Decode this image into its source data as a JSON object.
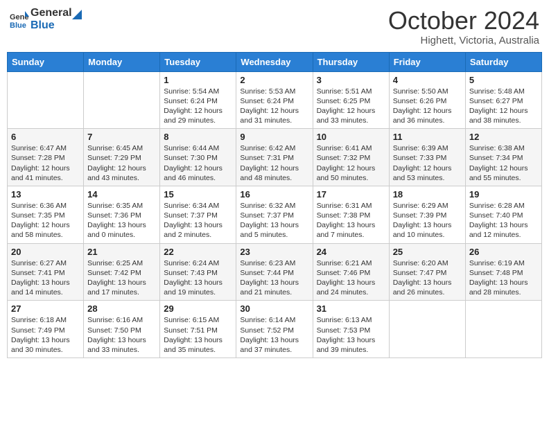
{
  "header": {
    "logo_line1": "General",
    "logo_line2": "Blue",
    "month_title": "October 2024",
    "subtitle": "Highett, Victoria, Australia"
  },
  "weekdays": [
    "Sunday",
    "Monday",
    "Tuesday",
    "Wednesday",
    "Thursday",
    "Friday",
    "Saturday"
  ],
  "weeks": [
    [
      {
        "day": "",
        "info": ""
      },
      {
        "day": "",
        "info": ""
      },
      {
        "day": "1",
        "info": "Sunrise: 5:54 AM\nSunset: 6:24 PM\nDaylight: 12 hours and 29 minutes."
      },
      {
        "day": "2",
        "info": "Sunrise: 5:53 AM\nSunset: 6:24 PM\nDaylight: 12 hours and 31 minutes."
      },
      {
        "day": "3",
        "info": "Sunrise: 5:51 AM\nSunset: 6:25 PM\nDaylight: 12 hours and 33 minutes."
      },
      {
        "day": "4",
        "info": "Sunrise: 5:50 AM\nSunset: 6:26 PM\nDaylight: 12 hours and 36 minutes."
      },
      {
        "day": "5",
        "info": "Sunrise: 5:48 AM\nSunset: 6:27 PM\nDaylight: 12 hours and 38 minutes."
      }
    ],
    [
      {
        "day": "6",
        "info": "Sunrise: 6:47 AM\nSunset: 7:28 PM\nDaylight: 12 hours and 41 minutes."
      },
      {
        "day": "7",
        "info": "Sunrise: 6:45 AM\nSunset: 7:29 PM\nDaylight: 12 hours and 43 minutes."
      },
      {
        "day": "8",
        "info": "Sunrise: 6:44 AM\nSunset: 7:30 PM\nDaylight: 12 hours and 46 minutes."
      },
      {
        "day": "9",
        "info": "Sunrise: 6:42 AM\nSunset: 7:31 PM\nDaylight: 12 hours and 48 minutes."
      },
      {
        "day": "10",
        "info": "Sunrise: 6:41 AM\nSunset: 7:32 PM\nDaylight: 12 hours and 50 minutes."
      },
      {
        "day": "11",
        "info": "Sunrise: 6:39 AM\nSunset: 7:33 PM\nDaylight: 12 hours and 53 minutes."
      },
      {
        "day": "12",
        "info": "Sunrise: 6:38 AM\nSunset: 7:34 PM\nDaylight: 12 hours and 55 minutes."
      }
    ],
    [
      {
        "day": "13",
        "info": "Sunrise: 6:36 AM\nSunset: 7:35 PM\nDaylight: 12 hours and 58 minutes."
      },
      {
        "day": "14",
        "info": "Sunrise: 6:35 AM\nSunset: 7:36 PM\nDaylight: 13 hours and 0 minutes."
      },
      {
        "day": "15",
        "info": "Sunrise: 6:34 AM\nSunset: 7:37 PM\nDaylight: 13 hours and 2 minutes."
      },
      {
        "day": "16",
        "info": "Sunrise: 6:32 AM\nSunset: 7:37 PM\nDaylight: 13 hours and 5 minutes."
      },
      {
        "day": "17",
        "info": "Sunrise: 6:31 AM\nSunset: 7:38 PM\nDaylight: 13 hours and 7 minutes."
      },
      {
        "day": "18",
        "info": "Sunrise: 6:29 AM\nSunset: 7:39 PM\nDaylight: 13 hours and 10 minutes."
      },
      {
        "day": "19",
        "info": "Sunrise: 6:28 AM\nSunset: 7:40 PM\nDaylight: 13 hours and 12 minutes."
      }
    ],
    [
      {
        "day": "20",
        "info": "Sunrise: 6:27 AM\nSunset: 7:41 PM\nDaylight: 13 hours and 14 minutes."
      },
      {
        "day": "21",
        "info": "Sunrise: 6:25 AM\nSunset: 7:42 PM\nDaylight: 13 hours and 17 minutes."
      },
      {
        "day": "22",
        "info": "Sunrise: 6:24 AM\nSunset: 7:43 PM\nDaylight: 13 hours and 19 minutes."
      },
      {
        "day": "23",
        "info": "Sunrise: 6:23 AM\nSunset: 7:44 PM\nDaylight: 13 hours and 21 minutes."
      },
      {
        "day": "24",
        "info": "Sunrise: 6:21 AM\nSunset: 7:46 PM\nDaylight: 13 hours and 24 minutes."
      },
      {
        "day": "25",
        "info": "Sunrise: 6:20 AM\nSunset: 7:47 PM\nDaylight: 13 hours and 26 minutes."
      },
      {
        "day": "26",
        "info": "Sunrise: 6:19 AM\nSunset: 7:48 PM\nDaylight: 13 hours and 28 minutes."
      }
    ],
    [
      {
        "day": "27",
        "info": "Sunrise: 6:18 AM\nSunset: 7:49 PM\nDaylight: 13 hours and 30 minutes."
      },
      {
        "day": "28",
        "info": "Sunrise: 6:16 AM\nSunset: 7:50 PM\nDaylight: 13 hours and 33 minutes."
      },
      {
        "day": "29",
        "info": "Sunrise: 6:15 AM\nSunset: 7:51 PM\nDaylight: 13 hours and 35 minutes."
      },
      {
        "day": "30",
        "info": "Sunrise: 6:14 AM\nSunset: 7:52 PM\nDaylight: 13 hours and 37 minutes."
      },
      {
        "day": "31",
        "info": "Sunrise: 6:13 AM\nSunset: 7:53 PM\nDaylight: 13 hours and 39 minutes."
      },
      {
        "day": "",
        "info": ""
      },
      {
        "day": "",
        "info": ""
      }
    ]
  ]
}
